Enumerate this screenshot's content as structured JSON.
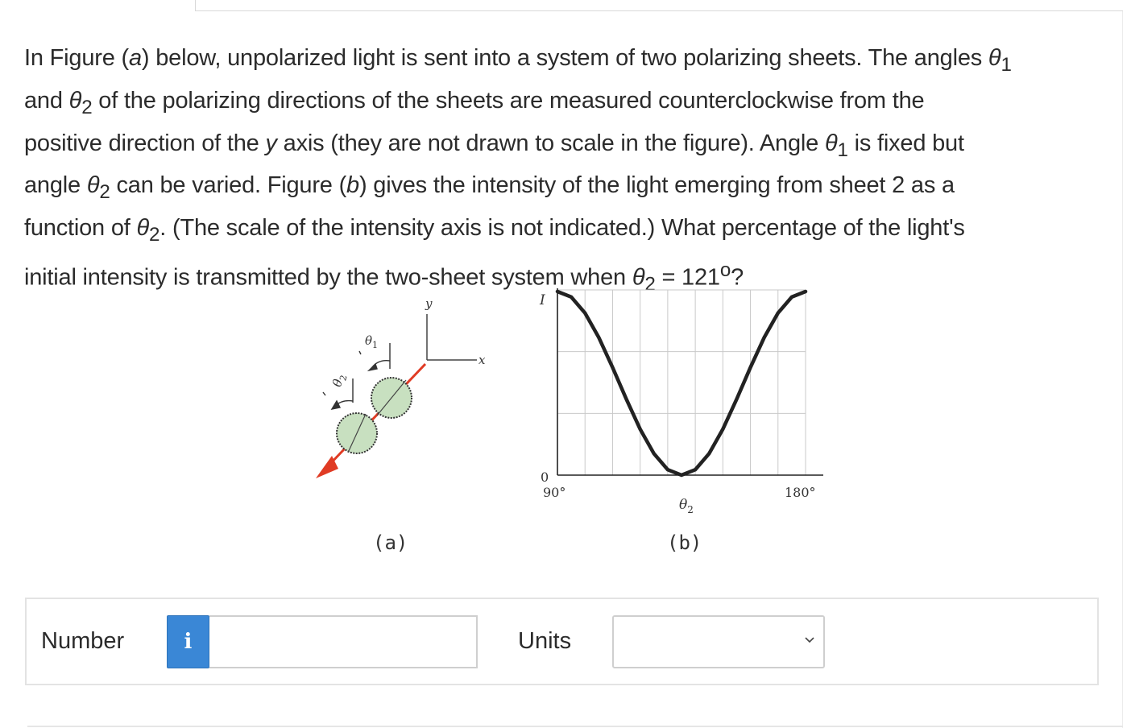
{
  "question": {
    "lines": [
      [
        "In Figure (",
        "a",
        ") below, unpolarized light is sent into a system of two polarizing sheets. The angles ",
        "θ",
        "1"
      ],
      [
        "and ",
        "θ",
        "2",
        " of the polarizing directions of the sheets are measured counterclockwise from the"
      ],
      [
        "positive direction of the ",
        "y",
        " axis (they are not drawn to scale in the figure). Angle ",
        "θ",
        "1",
        " is fixed but"
      ],
      [
        "angle ",
        "θ",
        "2",
        " can be varied. Figure (",
        "b",
        ") gives the intensity of the light emerging from sheet 2 as a"
      ],
      [
        "function of ",
        "θ",
        "2",
        ". (The scale of the intensity axis is not indicated.) What percentage of the light's"
      ],
      [
        "initial intensity is transmitted by the two-sheet system when ",
        "θ",
        "2",
        " = 121",
        "o",
        "?"
      ]
    ]
  },
  "figure_a": {
    "axis_y": "y",
    "axis_x": "x",
    "theta1": "θ",
    "theta1_sub": "1",
    "theta2": "θ",
    "theta2_sub": "2",
    "caption": "(a)",
    "sheet_color": "#c8e0c0",
    "arrow_color": "#e03b24"
  },
  "figure_b": {
    "ylabel": "I",
    "origin": "0",
    "x_start": "90°",
    "x_end": "180°",
    "xlabel": "θ",
    "xlabel_sub": "2",
    "caption": "(b)"
  },
  "chart_data": {
    "type": "line",
    "xlabel": "θ2",
    "ylabel": "I",
    "xlim": [
      90,
      180
    ],
    "x_tick_labels": [
      "90°",
      "180°"
    ],
    "grid": true,
    "series": [
      {
        "x": [
          90,
          95,
          100,
          105,
          110,
          115,
          120,
          125,
          130,
          135,
          140,
          145,
          150,
          155,
          160,
          165,
          170,
          175,
          180
        ],
        "y": [
          1.0,
          0.97,
          0.883,
          0.75,
          0.587,
          0.413,
          0.25,
          0.117,
          0.03,
          0.0,
          0.03,
          0.117,
          0.25,
          0.413,
          0.587,
          0.75,
          0.883,
          0.97,
          1.0
        ]
      }
    ]
  },
  "answer": {
    "number_label": "Number",
    "info_icon": "i",
    "number_value": "",
    "units_label": "Units",
    "units_value": ""
  }
}
